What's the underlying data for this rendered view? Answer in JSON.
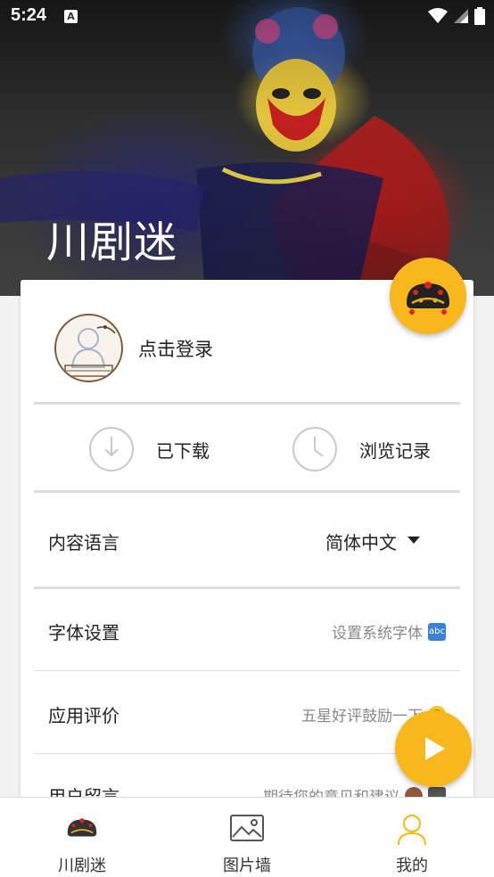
{
  "status_bar": {
    "time": "5:24",
    "notification_icon": "A"
  },
  "header": {
    "title": "川剧迷"
  },
  "profile": {
    "login_label": "点击登录"
  },
  "quick_actions": [
    {
      "label": "已下载",
      "icon": "download-icon"
    },
    {
      "label": "浏览记录",
      "icon": "clock-icon"
    }
  ],
  "settings": {
    "language": {
      "label": "内容语言",
      "value": "简体中文"
    },
    "font": {
      "label": "字体设置",
      "value": "设置系统字体"
    },
    "rating": {
      "label": "应用评价",
      "value": "五星好评鼓励一下"
    },
    "feedback": {
      "label": "用户留言",
      "value": "期待您的意见和建议"
    }
  },
  "bottom_nav": [
    {
      "label": "川剧迷",
      "icon": "opera-crown-icon"
    },
    {
      "label": "图片墙",
      "icon": "image-icon"
    },
    {
      "label": "我的",
      "icon": "user-icon"
    }
  ],
  "colors": {
    "accent": "#f8b71c",
    "divider": "#dcdcdc",
    "active_nav": "#f8b71c"
  }
}
